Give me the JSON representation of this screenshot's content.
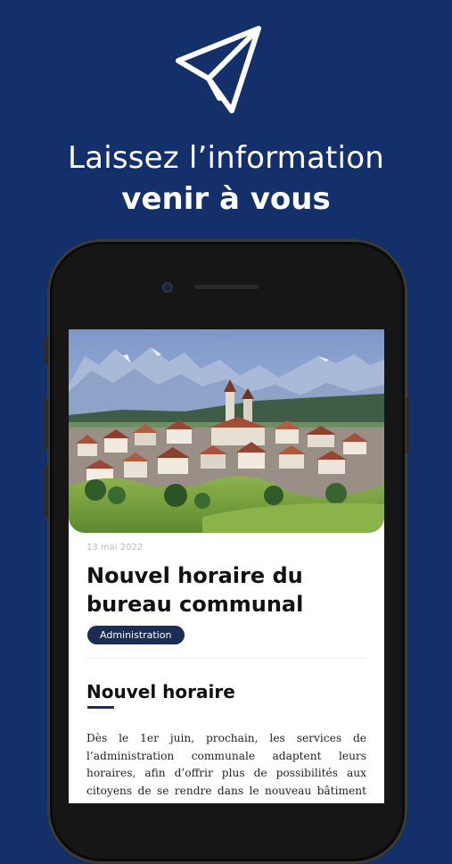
{
  "promo": {
    "headline_line1": "Laissez l’information",
    "headline_line2": "venir à vous",
    "icon": "paper-plane-icon"
  },
  "article": {
    "date": "13 mai 2022",
    "title": "Nouvel horaire du bureau communal",
    "tag": "Administration",
    "section_heading": "Nouvel horaire",
    "body": "Dès le 1er juin, prochain, les services de l’administration communale adaptent leurs horaires, afin d’offrir plus de possibilités aux citoyens de se rendre dans le nouveau bâtiment administratif.",
    "image": "village-mountain-photo"
  },
  "colors": {
    "background": "#14306b",
    "tag_background": "#1b2c55",
    "text": "#111111"
  }
}
